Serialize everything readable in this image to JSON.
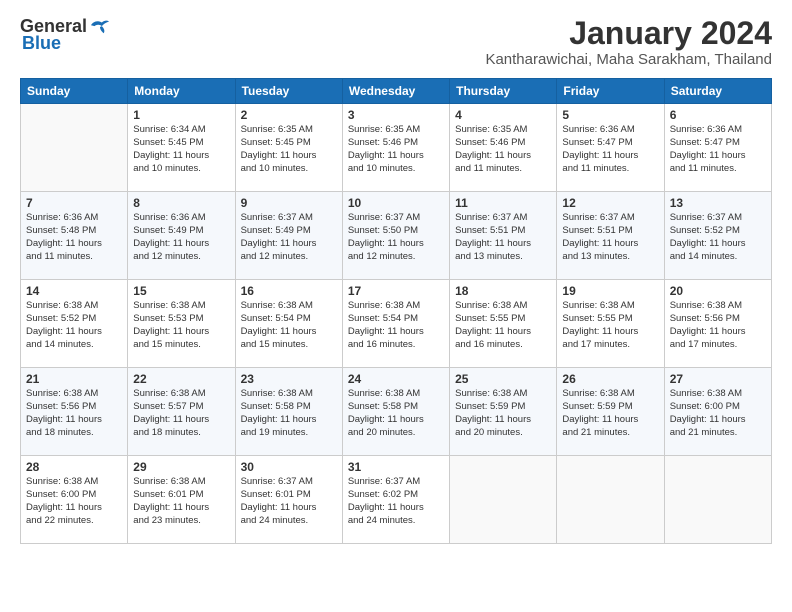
{
  "header": {
    "logo_general": "General",
    "logo_blue": "Blue",
    "title": "January 2024",
    "subtitle": "Kantharawichai, Maha Sarakham, Thailand"
  },
  "weekdays": [
    "Sunday",
    "Monday",
    "Tuesday",
    "Wednesday",
    "Thursday",
    "Friday",
    "Saturday"
  ],
  "weeks": [
    [
      {
        "day": "",
        "info": ""
      },
      {
        "day": "1",
        "info": "Sunrise: 6:34 AM\nSunset: 5:45 PM\nDaylight: 11 hours\nand 10 minutes."
      },
      {
        "day": "2",
        "info": "Sunrise: 6:35 AM\nSunset: 5:45 PM\nDaylight: 11 hours\nand 10 minutes."
      },
      {
        "day": "3",
        "info": "Sunrise: 6:35 AM\nSunset: 5:46 PM\nDaylight: 11 hours\nand 10 minutes."
      },
      {
        "day": "4",
        "info": "Sunrise: 6:35 AM\nSunset: 5:46 PM\nDaylight: 11 hours\nand 11 minutes."
      },
      {
        "day": "5",
        "info": "Sunrise: 6:36 AM\nSunset: 5:47 PM\nDaylight: 11 hours\nand 11 minutes."
      },
      {
        "day": "6",
        "info": "Sunrise: 6:36 AM\nSunset: 5:47 PM\nDaylight: 11 hours\nand 11 minutes."
      }
    ],
    [
      {
        "day": "7",
        "info": "Sunrise: 6:36 AM\nSunset: 5:48 PM\nDaylight: 11 hours\nand 11 minutes."
      },
      {
        "day": "8",
        "info": "Sunrise: 6:36 AM\nSunset: 5:49 PM\nDaylight: 11 hours\nand 12 minutes."
      },
      {
        "day": "9",
        "info": "Sunrise: 6:37 AM\nSunset: 5:49 PM\nDaylight: 11 hours\nand 12 minutes."
      },
      {
        "day": "10",
        "info": "Sunrise: 6:37 AM\nSunset: 5:50 PM\nDaylight: 11 hours\nand 12 minutes."
      },
      {
        "day": "11",
        "info": "Sunrise: 6:37 AM\nSunset: 5:51 PM\nDaylight: 11 hours\nand 13 minutes."
      },
      {
        "day": "12",
        "info": "Sunrise: 6:37 AM\nSunset: 5:51 PM\nDaylight: 11 hours\nand 13 minutes."
      },
      {
        "day": "13",
        "info": "Sunrise: 6:37 AM\nSunset: 5:52 PM\nDaylight: 11 hours\nand 14 minutes."
      }
    ],
    [
      {
        "day": "14",
        "info": "Sunrise: 6:38 AM\nSunset: 5:52 PM\nDaylight: 11 hours\nand 14 minutes."
      },
      {
        "day": "15",
        "info": "Sunrise: 6:38 AM\nSunset: 5:53 PM\nDaylight: 11 hours\nand 15 minutes."
      },
      {
        "day": "16",
        "info": "Sunrise: 6:38 AM\nSunset: 5:54 PM\nDaylight: 11 hours\nand 15 minutes."
      },
      {
        "day": "17",
        "info": "Sunrise: 6:38 AM\nSunset: 5:54 PM\nDaylight: 11 hours\nand 16 minutes."
      },
      {
        "day": "18",
        "info": "Sunrise: 6:38 AM\nSunset: 5:55 PM\nDaylight: 11 hours\nand 16 minutes."
      },
      {
        "day": "19",
        "info": "Sunrise: 6:38 AM\nSunset: 5:55 PM\nDaylight: 11 hours\nand 17 minutes."
      },
      {
        "day": "20",
        "info": "Sunrise: 6:38 AM\nSunset: 5:56 PM\nDaylight: 11 hours\nand 17 minutes."
      }
    ],
    [
      {
        "day": "21",
        "info": "Sunrise: 6:38 AM\nSunset: 5:56 PM\nDaylight: 11 hours\nand 18 minutes."
      },
      {
        "day": "22",
        "info": "Sunrise: 6:38 AM\nSunset: 5:57 PM\nDaylight: 11 hours\nand 18 minutes."
      },
      {
        "day": "23",
        "info": "Sunrise: 6:38 AM\nSunset: 5:58 PM\nDaylight: 11 hours\nand 19 minutes."
      },
      {
        "day": "24",
        "info": "Sunrise: 6:38 AM\nSunset: 5:58 PM\nDaylight: 11 hours\nand 20 minutes."
      },
      {
        "day": "25",
        "info": "Sunrise: 6:38 AM\nSunset: 5:59 PM\nDaylight: 11 hours\nand 20 minutes."
      },
      {
        "day": "26",
        "info": "Sunrise: 6:38 AM\nSunset: 5:59 PM\nDaylight: 11 hours\nand 21 minutes."
      },
      {
        "day": "27",
        "info": "Sunrise: 6:38 AM\nSunset: 6:00 PM\nDaylight: 11 hours\nand 21 minutes."
      }
    ],
    [
      {
        "day": "28",
        "info": "Sunrise: 6:38 AM\nSunset: 6:00 PM\nDaylight: 11 hours\nand 22 minutes."
      },
      {
        "day": "29",
        "info": "Sunrise: 6:38 AM\nSunset: 6:01 PM\nDaylight: 11 hours\nand 23 minutes."
      },
      {
        "day": "30",
        "info": "Sunrise: 6:37 AM\nSunset: 6:01 PM\nDaylight: 11 hours\nand 24 minutes."
      },
      {
        "day": "31",
        "info": "Sunrise: 6:37 AM\nSunset: 6:02 PM\nDaylight: 11 hours\nand 24 minutes."
      },
      {
        "day": "",
        "info": ""
      },
      {
        "day": "",
        "info": ""
      },
      {
        "day": "",
        "info": ""
      }
    ]
  ]
}
